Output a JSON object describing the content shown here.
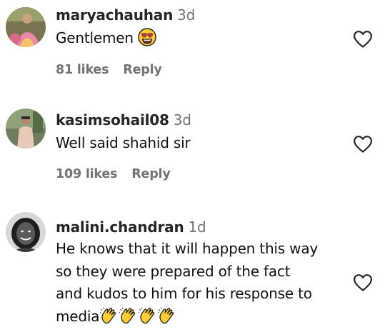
{
  "comments": [
    {
      "username": "maryachauhan",
      "age": "3d",
      "text": "Gentlemen",
      "emoji": "heart-eyes-emoji",
      "likes": "81 likes",
      "reply": "Reply"
    },
    {
      "username": "kasimsohail08",
      "age": "3d",
      "text": "Well said shahid sir",
      "likes": "109 likes",
      "reply": "Reply"
    },
    {
      "username": "malini.chandran",
      "age": "1d",
      "text_lines": [
        "He knows that it will happen this way",
        "so they were prepared of the fact",
        "and kudos to him for his response to",
        "media"
      ],
      "emoji": "clapping-hands-emoji"
    }
  ],
  "icons": {
    "like": "heart-outline-icon"
  },
  "colors": {
    "username": "#262626",
    "secondary": "#737373",
    "emoji_yellow": "#FFCC33",
    "heart_eyes_red": "#E8344A"
  }
}
